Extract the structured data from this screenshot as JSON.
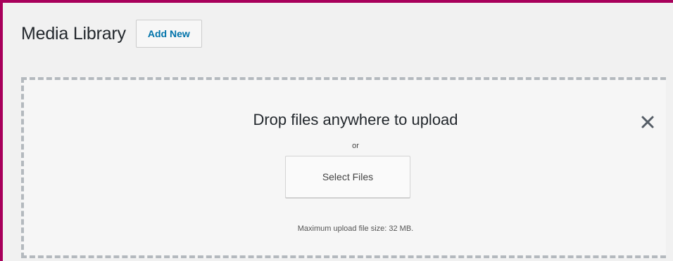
{
  "header": {
    "title": "Media Library",
    "add_new_label": "Add New"
  },
  "uploader": {
    "drop_title": "Drop files anywhere to upload",
    "or_text": "or",
    "select_files_label": "Select Files",
    "max_size_text": "Maximum upload file size: 32 MB.",
    "close_icon": "close-icon"
  },
  "colors": {
    "frame_border": "#a8005b",
    "link_blue": "#0073aa",
    "dashed_border": "#b4b9be",
    "background": "#f1f1f1"
  }
}
